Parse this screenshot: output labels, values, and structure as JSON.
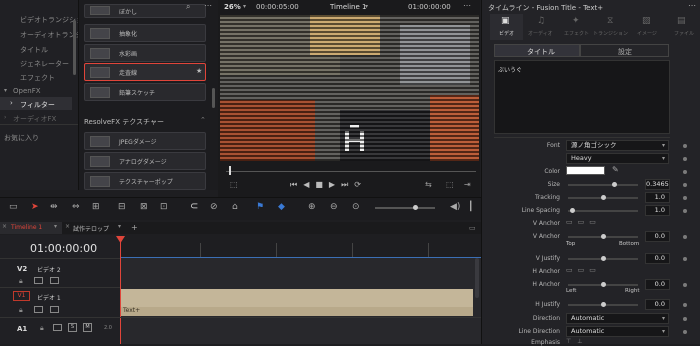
{
  "sidebar": {
    "items": [
      "ビデオトランジション",
      "オーディオトランジ",
      "タイトル",
      "ジェネレーター",
      "エフェクト"
    ],
    "openfx": "OpenFX",
    "filter": "フィルター",
    "audio_fx": "オーディオFX",
    "favorites": "お気に入り"
  },
  "effects": {
    "items": [
      "ぼかし",
      "抽象化",
      "水彩画",
      "走査線",
      "鉛筆スケッチ"
    ],
    "section": "ResolveFX テクスチャー",
    "texture_items": [
      "JPEGダメージ",
      "アナログダメージ",
      "テクスチャーポップ"
    ]
  },
  "viewer": {
    "zoom": "26%",
    "timecode_left": "00:00:05:00",
    "timeline_name": "Timeline 1",
    "timecode_right": "01:00:00:00"
  },
  "timeline": {
    "tabs": [
      "Timeline 1",
      "試作テロップ"
    ],
    "add_tab": "+",
    "timecode": "01:00:00:00",
    "tracks": [
      {
        "id": "V2",
        "name": "ビデオ 2"
      },
      {
        "id": "V1",
        "name": "ビデオ 1"
      },
      {
        "id": "A1",
        "name": ""
      }
    ],
    "clip_label": "Text+",
    "a1_level": "2.0"
  },
  "inspector": {
    "title": "タイムライン - Fusion Title - Text+",
    "tabs": [
      "ビデオ",
      "オーディオ",
      "エフェクト",
      "トランジション",
      "イメージ",
      "ファイル"
    ],
    "subtabs": [
      "タイトル",
      "設定"
    ],
    "text_value": "ぶいうぐ",
    "font_label": "Font",
    "font_value": "源ノ角ゴシック",
    "weight_value": "Heavy",
    "color_label": "Color",
    "size_label": "Size",
    "size_value": "0.3465",
    "tracking_label": "Tracking",
    "tracking_value": "1.0",
    "line_spacing_label": "Line Spacing",
    "line_spacing_value": "1.0",
    "v_anchor_label": "V Anchor",
    "v_anchor_value": "0.0",
    "top_label": "Top",
    "bottom_label": "Bottom",
    "v_justify_label": "V Justify",
    "v_justify_value": "0.0",
    "h_anchor_label": "H Anchor",
    "h_anchor2_label": "H Anchor",
    "h_anchor_value": "0.0",
    "left_label": "Left",
    "right_label": "Right",
    "h_justify_label": "H Justify",
    "h_justify_value": "0.0",
    "direction_label": "Direction",
    "direction_value": "Automatic",
    "line_direction_label": "Line Direction",
    "line_direction_value": "Automatic",
    "emphasis_label": "Emphasis"
  }
}
